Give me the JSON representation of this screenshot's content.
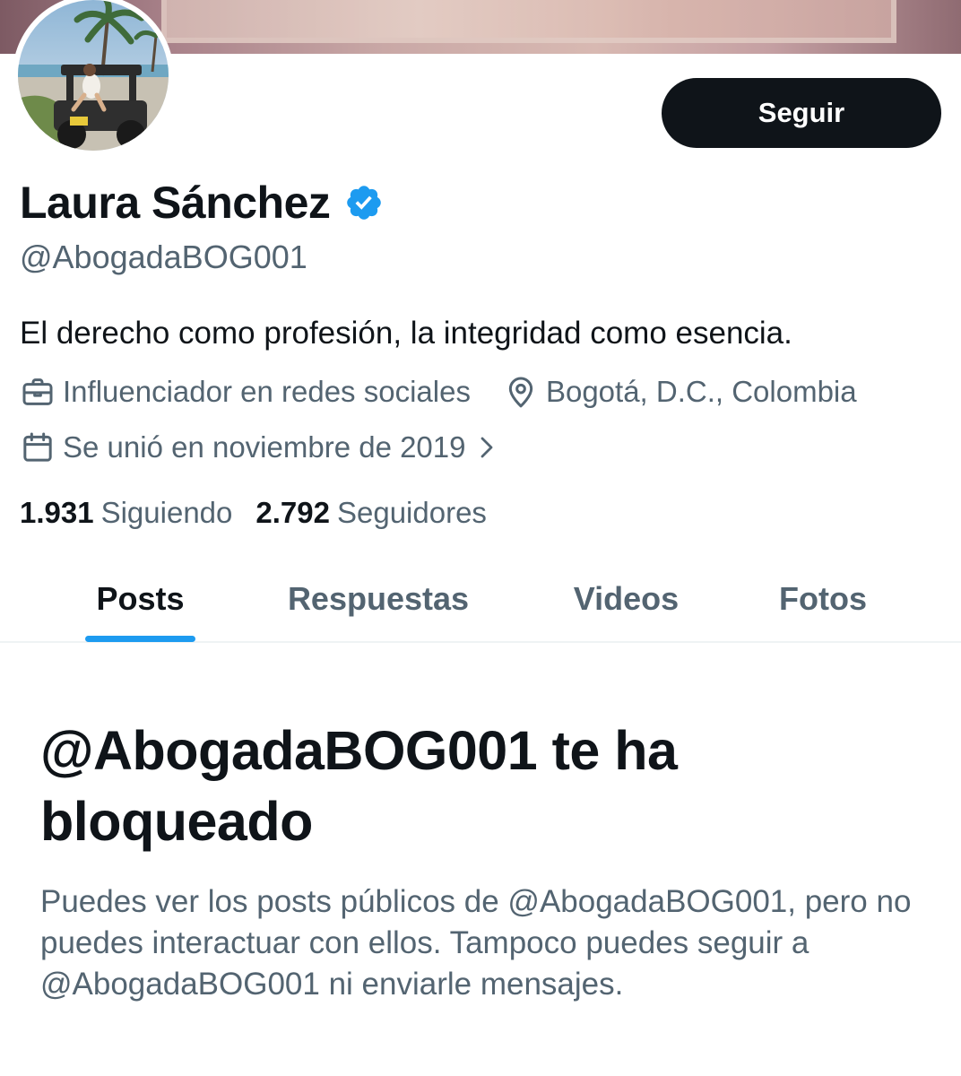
{
  "profile": {
    "follow_label": "Seguir",
    "display_name": "Laura Sánchez",
    "handle": "@AbogadaBOG001",
    "bio": "El derecho como profesión, la integridad como esencia.",
    "category": "Influenciador en redes sociales",
    "location": "Bogotá, D.C., Colombia",
    "joined": "Se unió en noviembre de 2019",
    "following_count": "1.931",
    "following_label": "Siguiendo",
    "followers_count": "2.792",
    "followers_label": "Seguidores"
  },
  "icons": {
    "verified": "verified-badge-icon",
    "category": "briefcase-icon",
    "location": "location-pin-icon",
    "joined": "calendar-icon",
    "more": "chevron-right-icon"
  },
  "tabs": [
    {
      "label": "Posts",
      "active": true
    },
    {
      "label": "Respuestas",
      "active": false
    },
    {
      "label": "Videos",
      "active": false
    },
    {
      "label": "Fotos",
      "active": false
    }
  ],
  "blocked": {
    "title": "@AbogadaBOG001 te ha bloqueado",
    "description": "Puedes ver los posts públicos de @AbogadaBOG001, pero no puedes interactuar con ellos. Tampoco puedes seguir a @AbogadaBOG001 ni enviarle mensajes."
  },
  "colors": {
    "text_primary": "#0f1419",
    "text_secondary": "#536471",
    "accent": "#1d9bf0",
    "button_bg": "#0f1419",
    "button_text": "#ffffff",
    "divider": "#eff3f4"
  }
}
